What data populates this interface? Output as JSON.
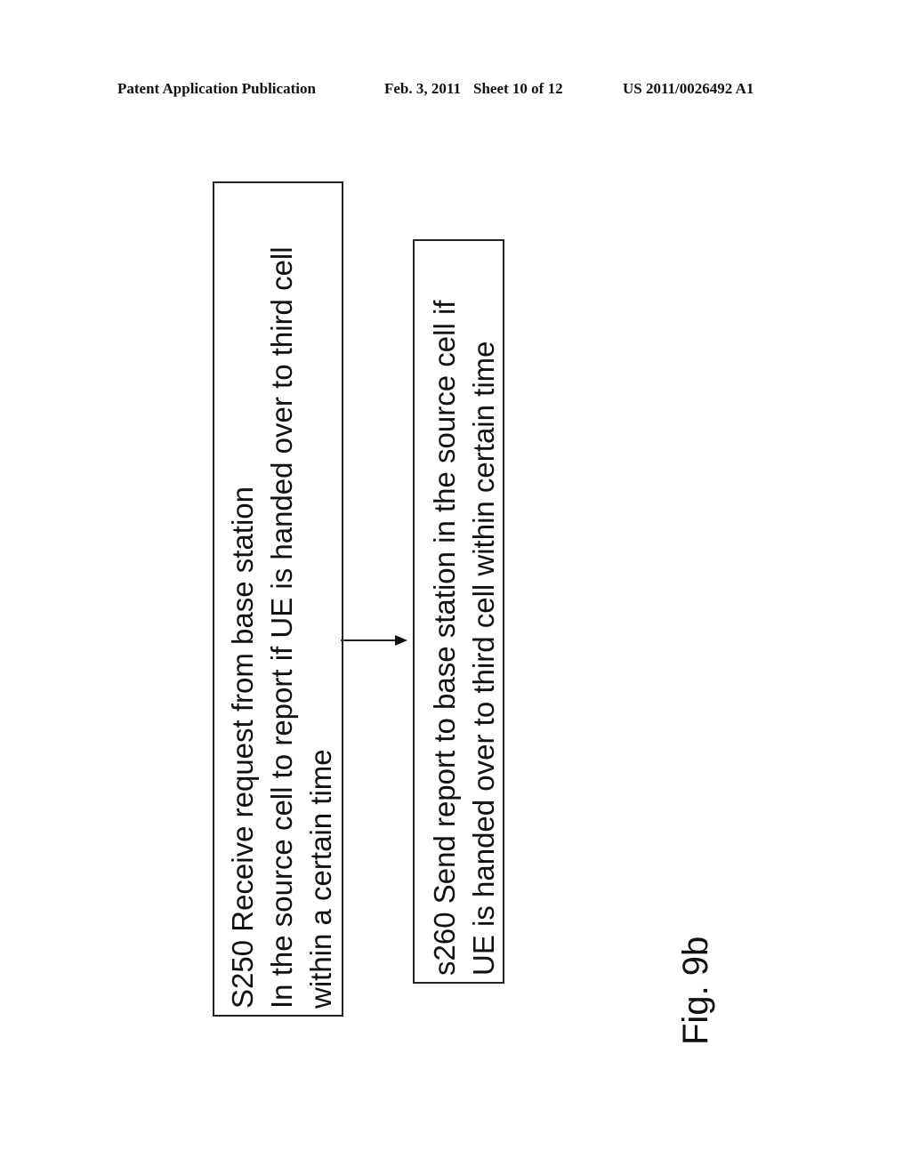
{
  "header": {
    "publication": "Patent Application Publication",
    "date": "Feb. 3, 2011",
    "sheet": "Sheet 10 of 12",
    "number": "US 2011/0026492 A1"
  },
  "diagram": {
    "steps": [
      {
        "id": "S250",
        "lines": [
          "S250 Receive request from base station",
          "In the source cell to report if UE is handed over to third cell",
          "within a certain time"
        ]
      },
      {
        "id": "s260",
        "lines": [
          "s260 Send report to base station in the source cell if",
          "UE is handed over to third cell within certain time"
        ]
      }
    ],
    "edges": [
      {
        "from": "S250",
        "to": "s260",
        "type": "arrow"
      }
    ],
    "figure_label": "Fig. 9b",
    "orientation": "rotated-90-ccw",
    "stroke_color": "#222222"
  }
}
